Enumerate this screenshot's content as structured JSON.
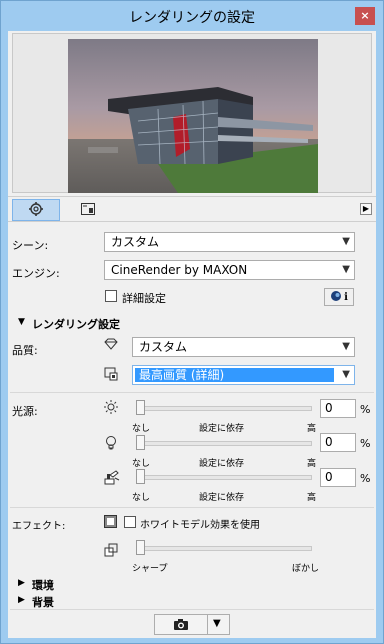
{
  "window": {
    "title": "レンダリングの設定",
    "close_glyph": "×"
  },
  "tabs": [
    {
      "icon": "gear-icon"
    },
    {
      "icon": "preview-frame-icon"
    }
  ],
  "scene": {
    "label": "シーン:",
    "value": "カスタム"
  },
  "engine": {
    "label": "エンジン:",
    "value": "CineRender by MAXON"
  },
  "details": {
    "label": "詳細設定",
    "checked": false,
    "info_glyph": "i"
  },
  "rendering_settings": {
    "title": "レンダリング設定",
    "quality_label": "品質:",
    "quality_value": "カスタム",
    "quality_sub_value": "最高画質 (詳細)"
  },
  "lights": {
    "label": "光源:",
    "sliders": [
      {
        "icon": "sun-icon",
        "value": "0",
        "unit": "%",
        "ticks": [
          "なし",
          "設定に依存",
          "高"
        ],
        "level": 0
      },
      {
        "icon": "bulb-icon",
        "value": "0",
        "unit": "%",
        "ticks": [
          "なし",
          "設定に依存",
          "高"
        ],
        "level": 0
      },
      {
        "icon": "lamp-icon",
        "value": "0",
        "unit": "%",
        "ticks": [
          "なし",
          "設定に依存",
          "高"
        ],
        "level": 0
      }
    ]
  },
  "effects": {
    "label": "エフェクト:",
    "white_model": "ホワイトモデル効果を使用",
    "white_model_checked": false,
    "blur_ticks": [
      "シャープ",
      "ぼかし"
    ],
    "blur_level": 0
  },
  "collapsed_sections": {
    "environment": "環境",
    "background": "背景"
  },
  "accent_color": "#3399ff",
  "titlebar_color": "#9ecbf0"
}
